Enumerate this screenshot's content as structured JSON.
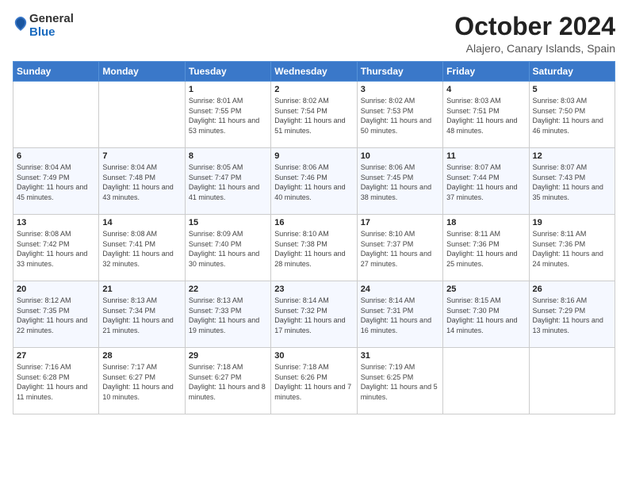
{
  "header": {
    "logo_general": "General",
    "logo_blue": "Blue",
    "month_title": "October 2024",
    "location": "Alajero, Canary Islands, Spain"
  },
  "days_of_week": [
    "Sunday",
    "Monday",
    "Tuesday",
    "Wednesday",
    "Thursday",
    "Friday",
    "Saturday"
  ],
  "weeks": [
    [
      {
        "day": "",
        "text": ""
      },
      {
        "day": "",
        "text": ""
      },
      {
        "day": "1",
        "text": "Sunrise: 8:01 AM\nSunset: 7:55 PM\nDaylight: 11 hours and 53 minutes."
      },
      {
        "day": "2",
        "text": "Sunrise: 8:02 AM\nSunset: 7:54 PM\nDaylight: 11 hours and 51 minutes."
      },
      {
        "day": "3",
        "text": "Sunrise: 8:02 AM\nSunset: 7:53 PM\nDaylight: 11 hours and 50 minutes."
      },
      {
        "day": "4",
        "text": "Sunrise: 8:03 AM\nSunset: 7:51 PM\nDaylight: 11 hours and 48 minutes."
      },
      {
        "day": "5",
        "text": "Sunrise: 8:03 AM\nSunset: 7:50 PM\nDaylight: 11 hours and 46 minutes."
      }
    ],
    [
      {
        "day": "6",
        "text": "Sunrise: 8:04 AM\nSunset: 7:49 PM\nDaylight: 11 hours and 45 minutes."
      },
      {
        "day": "7",
        "text": "Sunrise: 8:04 AM\nSunset: 7:48 PM\nDaylight: 11 hours and 43 minutes."
      },
      {
        "day": "8",
        "text": "Sunrise: 8:05 AM\nSunset: 7:47 PM\nDaylight: 11 hours and 41 minutes."
      },
      {
        "day": "9",
        "text": "Sunrise: 8:06 AM\nSunset: 7:46 PM\nDaylight: 11 hours and 40 minutes."
      },
      {
        "day": "10",
        "text": "Sunrise: 8:06 AM\nSunset: 7:45 PM\nDaylight: 11 hours and 38 minutes."
      },
      {
        "day": "11",
        "text": "Sunrise: 8:07 AM\nSunset: 7:44 PM\nDaylight: 11 hours and 37 minutes."
      },
      {
        "day": "12",
        "text": "Sunrise: 8:07 AM\nSunset: 7:43 PM\nDaylight: 11 hours and 35 minutes."
      }
    ],
    [
      {
        "day": "13",
        "text": "Sunrise: 8:08 AM\nSunset: 7:42 PM\nDaylight: 11 hours and 33 minutes."
      },
      {
        "day": "14",
        "text": "Sunrise: 8:08 AM\nSunset: 7:41 PM\nDaylight: 11 hours and 32 minutes."
      },
      {
        "day": "15",
        "text": "Sunrise: 8:09 AM\nSunset: 7:40 PM\nDaylight: 11 hours and 30 minutes."
      },
      {
        "day": "16",
        "text": "Sunrise: 8:10 AM\nSunset: 7:38 PM\nDaylight: 11 hours and 28 minutes."
      },
      {
        "day": "17",
        "text": "Sunrise: 8:10 AM\nSunset: 7:37 PM\nDaylight: 11 hours and 27 minutes."
      },
      {
        "day": "18",
        "text": "Sunrise: 8:11 AM\nSunset: 7:36 PM\nDaylight: 11 hours and 25 minutes."
      },
      {
        "day": "19",
        "text": "Sunrise: 8:11 AM\nSunset: 7:36 PM\nDaylight: 11 hours and 24 minutes."
      }
    ],
    [
      {
        "day": "20",
        "text": "Sunrise: 8:12 AM\nSunset: 7:35 PM\nDaylight: 11 hours and 22 minutes."
      },
      {
        "day": "21",
        "text": "Sunrise: 8:13 AM\nSunset: 7:34 PM\nDaylight: 11 hours and 21 minutes."
      },
      {
        "day": "22",
        "text": "Sunrise: 8:13 AM\nSunset: 7:33 PM\nDaylight: 11 hours and 19 minutes."
      },
      {
        "day": "23",
        "text": "Sunrise: 8:14 AM\nSunset: 7:32 PM\nDaylight: 11 hours and 17 minutes."
      },
      {
        "day": "24",
        "text": "Sunrise: 8:14 AM\nSunset: 7:31 PM\nDaylight: 11 hours and 16 minutes."
      },
      {
        "day": "25",
        "text": "Sunrise: 8:15 AM\nSunset: 7:30 PM\nDaylight: 11 hours and 14 minutes."
      },
      {
        "day": "26",
        "text": "Sunrise: 8:16 AM\nSunset: 7:29 PM\nDaylight: 11 hours and 13 minutes."
      }
    ],
    [
      {
        "day": "27",
        "text": "Sunrise: 7:16 AM\nSunset: 6:28 PM\nDaylight: 11 hours and 11 minutes."
      },
      {
        "day": "28",
        "text": "Sunrise: 7:17 AM\nSunset: 6:27 PM\nDaylight: 11 hours and 10 minutes."
      },
      {
        "day": "29",
        "text": "Sunrise: 7:18 AM\nSunset: 6:27 PM\nDaylight: 11 hours and 8 minutes."
      },
      {
        "day": "30",
        "text": "Sunrise: 7:18 AM\nSunset: 6:26 PM\nDaylight: 11 hours and 7 minutes."
      },
      {
        "day": "31",
        "text": "Sunrise: 7:19 AM\nSunset: 6:25 PM\nDaylight: 11 hours and 5 minutes."
      },
      {
        "day": "",
        "text": ""
      },
      {
        "day": "",
        "text": ""
      }
    ]
  ]
}
